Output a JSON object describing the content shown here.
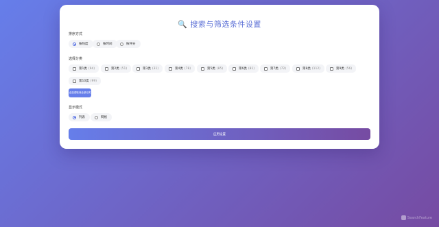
{
  "header": {
    "title": "🔍 搜索与筛选条件设置"
  },
  "section1": {
    "label": "排序方式",
    "options": [
      {
        "label": "按热度",
        "selected": true
      },
      {
        "label": "按时间",
        "selected": false
      },
      {
        "label": "按评分",
        "selected": false
      }
    ]
  },
  "section2": {
    "label": "选择分类",
    "items": [
      {
        "label": "第1类",
        "count": "(94)"
      },
      {
        "label": "第2类",
        "count": "(51)"
      },
      {
        "label": "第3类",
        "count": "(31)"
      },
      {
        "label": "第4类",
        "count": "(78)"
      },
      {
        "label": "第5类",
        "count": "(85)"
      },
      {
        "label": "第6类",
        "count": "(81)"
      },
      {
        "label": "第7类",
        "count": "(72)"
      },
      {
        "label": "第8类",
        "count": "(112)"
      },
      {
        "label": "第9类",
        "count": "(56)"
      },
      {
        "label": "第10类",
        "count": "(99)"
      }
    ],
    "select_all_label": "全选或取消全部分类"
  },
  "section3": {
    "label": "显示模式",
    "options": [
      {
        "label": "列表",
        "selected": true
      },
      {
        "label": "网格",
        "selected": false
      }
    ]
  },
  "submit_label": "应用设置",
  "watermark": "SearchFeature",
  "colors": {
    "accent": "#667eea",
    "accent_end": "#764ba2"
  }
}
